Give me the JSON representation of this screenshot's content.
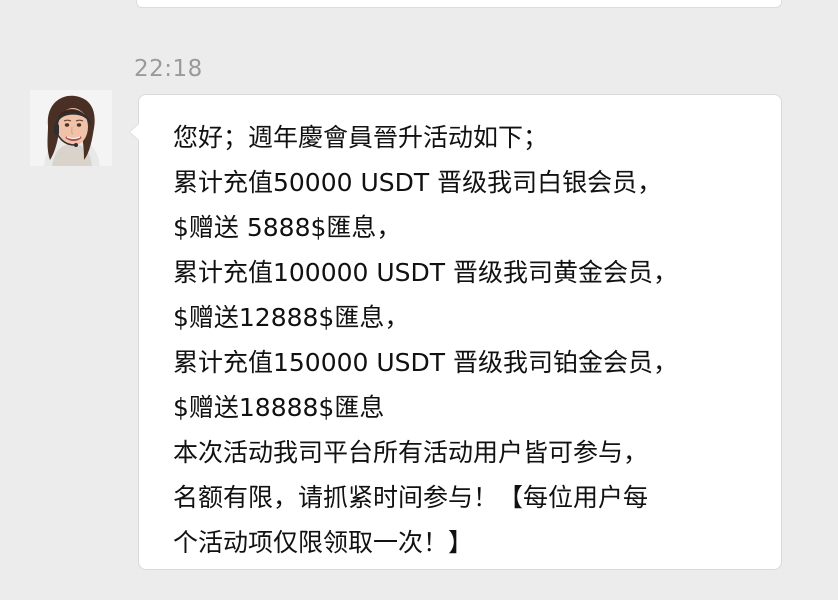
{
  "chat": {
    "timestamp": "22:18",
    "sender": {
      "avatar_icon": "customer-service-agent-avatar"
    },
    "message": {
      "lines": [
        "您好；週年慶會員晉升活动如下；",
        "累计充值50000 USDT 晋级我司白银会员，",
        "$赠送 5888$匯息，",
        "累计充值100000 USDT 晋级我司黄金会员，",
        "$赠送12888$匯息，",
        "累计充值150000 USDT 晋级我司铂金会员，",
        "$赠送18888$匯息",
        "本次活动我司平台所有活动用户皆可参与，",
        "名额有限，请抓紧时间参与！【每位用户每",
        "个活动项仅限领取一次！】"
      ]
    }
  },
  "colors": {
    "background": "#ececec",
    "bubble": "#ffffff",
    "timestamp": "#9a9a9a",
    "text": "#111111"
  }
}
